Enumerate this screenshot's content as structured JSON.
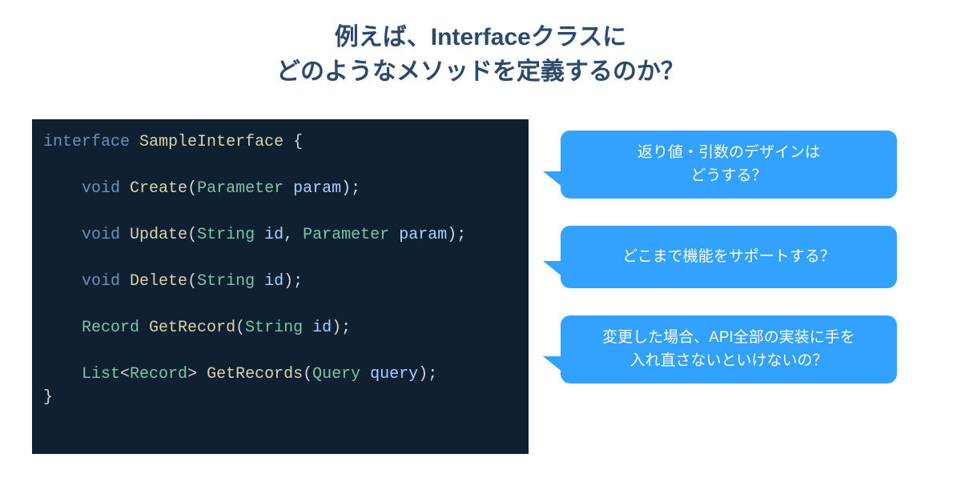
{
  "title": {
    "line1": "例えば、Interfaceクラスに",
    "line2": "どのようなメソッドを定義するのか？"
  },
  "code": {
    "interface_kw": "interface",
    "interface_name": "SampleInterface",
    "open": "{",
    "methods": {
      "m1": {
        "ret": "void",
        "name": "Create",
        "p1t": "Parameter",
        "p1n": "param"
      },
      "m2": {
        "ret": "void",
        "name": "Update",
        "p1t": "String",
        "p1n": "id",
        "p2t": "Parameter",
        "p2n": "param"
      },
      "m3": {
        "ret": "void",
        "name": "Delete",
        "p1t": "String",
        "p1n": "id"
      },
      "m4": {
        "ret": "Record",
        "name": "GetRecord",
        "p1t": "String",
        "p1n": "id"
      },
      "m5": {
        "rett": "List",
        "retg": "Record",
        "name": "GetRecords",
        "p1t": "Query",
        "p1n": "query"
      }
    },
    "close": "}"
  },
  "bubbles": {
    "b1": "返り値・引数のデザインは\nどうする？",
    "b2": "どこまで機能をサポートする？",
    "b3": "変更した場合、API全部の実装に手を\n入れ直さないといけないの？"
  },
  "punct": {
    "lt": "<",
    "gt": ">",
    "lp": "(",
    "rp": ")",
    "sc": ";",
    "cm": ", ",
    "sp": " ",
    "ind": "    "
  }
}
